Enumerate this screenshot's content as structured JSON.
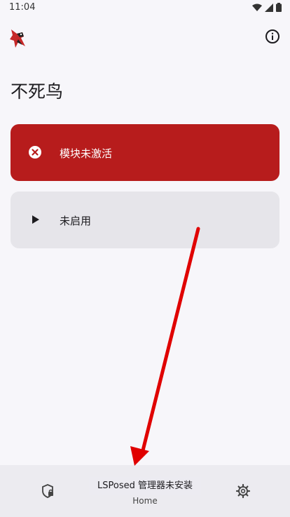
{
  "status_bar": {
    "time": "11:04"
  },
  "page": {
    "title": "不死鸟"
  },
  "cards": {
    "module_status": {
      "label": "模块未激活",
      "icon": "close-circle-icon",
      "color": "#b71c1c"
    },
    "service_status": {
      "label": "未启用",
      "icon": "play-icon"
    }
  },
  "bottom_nav": {
    "items": [
      {
        "icon": "shield-lock-icon",
        "label": ""
      },
      {
        "icon": "home-icon",
        "label": "Home"
      },
      {
        "icon": "gear-icon",
        "label": ""
      }
    ]
  },
  "toast": {
    "text": "LSPosed 管理器未安装"
  },
  "colors": {
    "accent_error": "#b71c1c",
    "arrow": "#e00000"
  }
}
